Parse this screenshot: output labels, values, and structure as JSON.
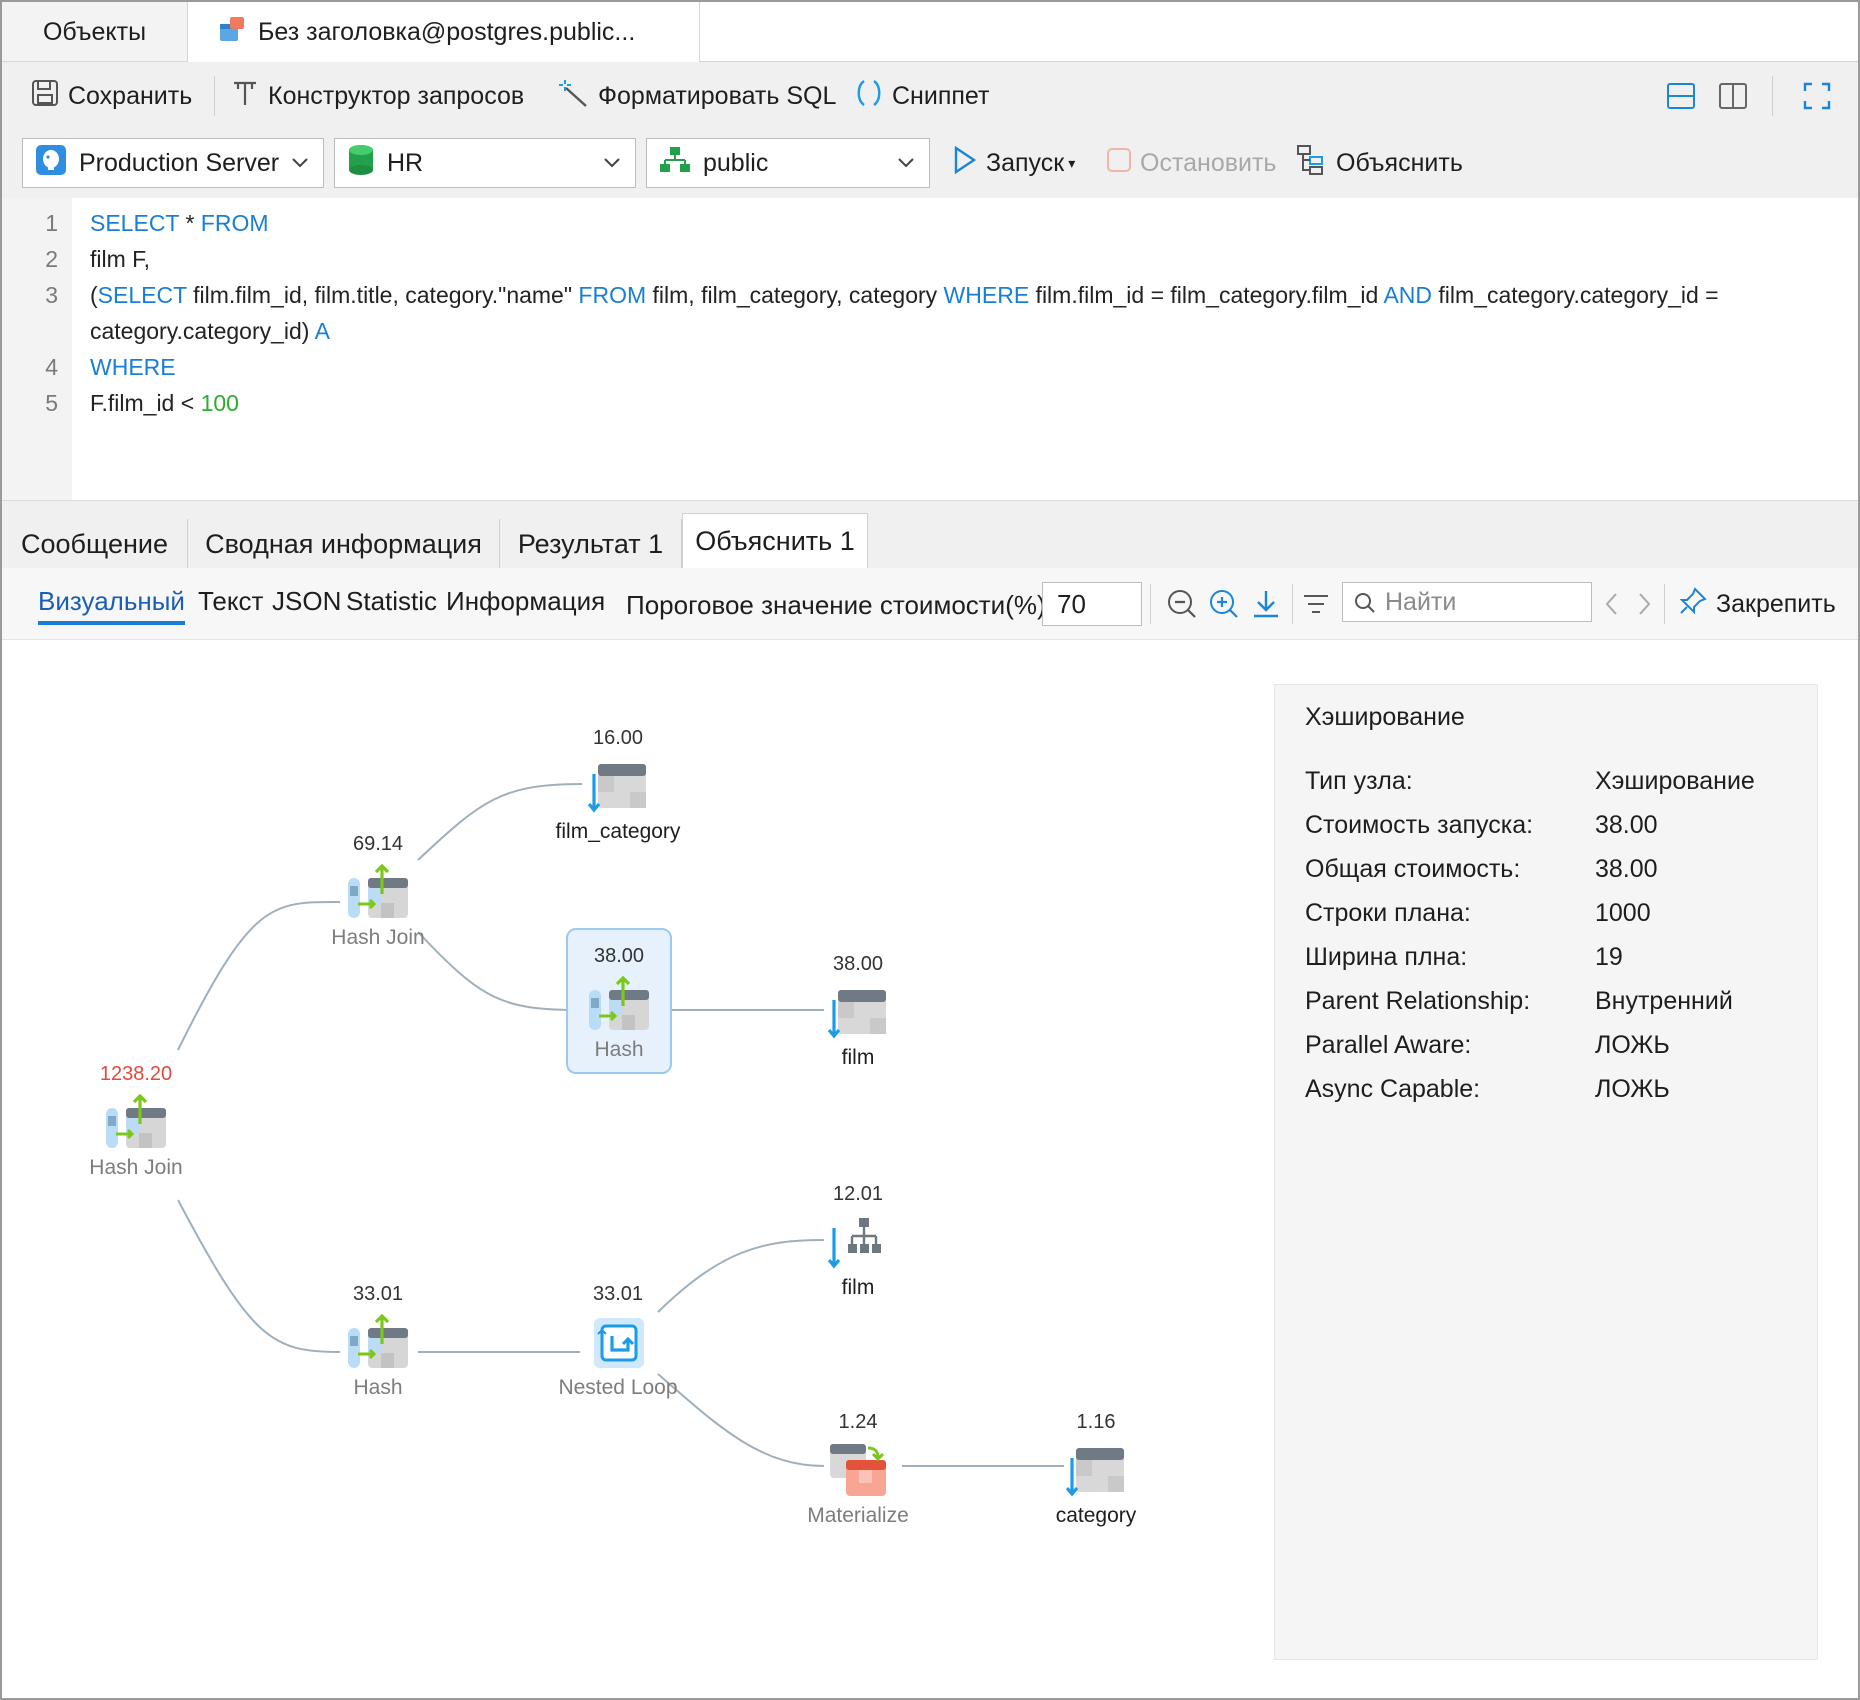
{
  "doc_tabs": [
    {
      "label": "Объекты"
    },
    {
      "label": "Без заголовка@postgres.public..."
    }
  ],
  "toolbar": {
    "save": "Сохранить",
    "query_builder": "Конструктор запросов",
    "format_sql": "Форматировать SQL",
    "snippet": "Сниппет",
    "connection": "Production Server",
    "database": "HR",
    "schema": "public",
    "run": "Запуск",
    "stop": "Остановить",
    "explain": "Объяснить"
  },
  "editor": {
    "lines": [
      {
        "n": "1",
        "segments": [
          {
            "t": "SELECT",
            "k": "kw"
          },
          {
            "t": " * ",
            "k": ""
          },
          {
            "t": "FROM",
            "k": "kw"
          }
        ]
      },
      {
        "n": "2",
        "segments": [
          {
            "t": "film F,",
            "k": ""
          }
        ]
      },
      {
        "n": "3",
        "segments": [
          {
            "t": "(",
            "k": ""
          },
          {
            "t": "SELECT",
            "k": "kw"
          },
          {
            "t": " film.film_id, film.title, category.\"name\" ",
            "k": ""
          },
          {
            "t": "FROM",
            "k": "kw"
          },
          {
            "t": " film, film_category, category ",
            "k": ""
          },
          {
            "t": "WHERE",
            "k": "kw"
          },
          {
            "t": " film.film_id = film_category.film_id ",
            "k": ""
          },
          {
            "t": "AND",
            "k": "kw"
          },
          {
            "t": " film_category.category_id =",
            "k": ""
          }
        ]
      },
      {
        "n": "",
        "segments": [
          {
            "t": "category.category_id) ",
            "k": ""
          },
          {
            "t": "A",
            "k": "kw"
          }
        ]
      },
      {
        "n": "4",
        "segments": [
          {
            "t": "WHERE",
            "k": "kw"
          }
        ]
      },
      {
        "n": "5",
        "segments": [
          {
            "t": "F.film_id < ",
            "k": ""
          },
          {
            "t": "100",
            "k": "num"
          }
        ]
      }
    ]
  },
  "result_tabs": [
    {
      "label": "Сообщение"
    },
    {
      "label": "Сводная информация"
    },
    {
      "label": "Результат 1"
    },
    {
      "label": "Объяснить 1"
    }
  ],
  "explain_bar": {
    "views": [
      "Визуальный",
      "Текст",
      "JSON",
      "Statistic",
      "Информация"
    ],
    "threshold_label": "Пороговое значение стоимости(%):",
    "threshold_value": "70",
    "find_placeholder": "Найти",
    "pin": "Закрепить"
  },
  "plan_nodes": [
    {
      "id": "hashjoin-root",
      "cost": "1238.20",
      "label": "Hash Join",
      "icon": "hash-join-icon",
      "highlight": true
    },
    {
      "id": "hashjoin-top",
      "cost": "69.14",
      "label": "Hash Join",
      "icon": "hash-join-icon"
    },
    {
      "id": "film-category-scan",
      "cost": "16.00",
      "label": "film_category",
      "icon": "table-scan-icon"
    },
    {
      "id": "hash-top",
      "cost": "38.00",
      "label": "Hash",
      "icon": "hash-icon",
      "selected": true
    },
    {
      "id": "film-scan",
      "cost": "38.00",
      "label": "film",
      "icon": "table-scan-icon"
    },
    {
      "id": "hash-bottom",
      "cost": "33.01",
      "label": "Hash",
      "icon": "hash-icon"
    },
    {
      "id": "nested-loop",
      "cost": "33.01",
      "label": "Nested Loop",
      "icon": "nested-loop-icon"
    },
    {
      "id": "film-index-scan",
      "cost": "12.01",
      "label": "film",
      "icon": "index-scan-icon"
    },
    {
      "id": "materialize",
      "cost": "1.24",
      "label": "Materialize",
      "icon": "materialize-icon"
    },
    {
      "id": "category-scan",
      "cost": "1.16",
      "label": "category",
      "icon": "table-scan-icon"
    }
  ],
  "detail": {
    "title": "Хэширование",
    "rows": [
      {
        "k": "Тип узла:",
        "v": "Хэширование"
      },
      {
        "k": "Стоимость запуска:",
        "v": "38.00"
      },
      {
        "k": "Общая стоимость:",
        "v": "38.00"
      },
      {
        "k": "Строки плана:",
        "v": "1000"
      },
      {
        "k": "Ширина плна:",
        "v": "19"
      },
      {
        "k": "Parent Relationship:",
        "v": "Внутренний"
      },
      {
        "k": "Parallel Aware:",
        "v": "ЛОЖЬ"
      },
      {
        "k": "Async Capable:",
        "v": "ЛОЖЬ"
      }
    ]
  },
  "colors": {
    "accent": "#1a7fd4",
    "keyword": "#1a7fd4",
    "number": "#2dad2d",
    "high_cost": "#e24a3b",
    "arrow_green": "#7ac819",
    "arrow_blue": "#1b9be8"
  }
}
